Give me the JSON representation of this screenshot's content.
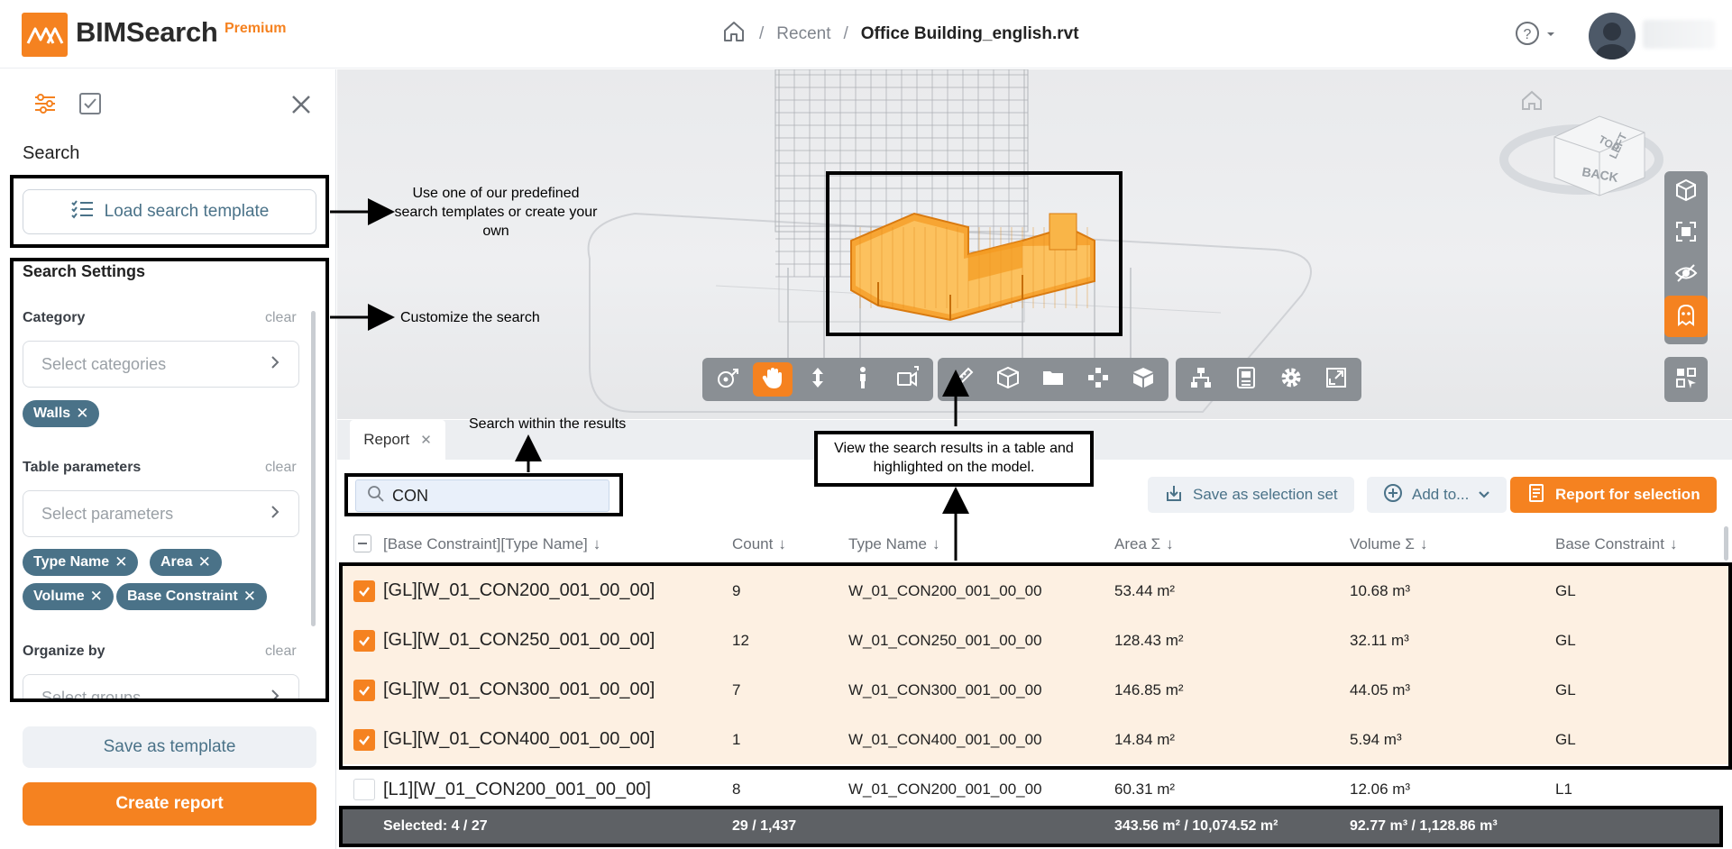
{
  "header": {
    "logo_text": "BIMSearch",
    "logo_badge": "Premium",
    "breadcrumb": {
      "recent": "Recent",
      "separator": "/",
      "file": "Office Building_english.rvt"
    }
  },
  "sidebar": {
    "search_title": "Search",
    "load_template_label": "Load search template",
    "settings_title": "Search Settings",
    "category": {
      "label": "Category",
      "clear": "clear",
      "placeholder": "Select categories",
      "chips": [
        "Walls"
      ]
    },
    "table_parameters": {
      "label": "Table parameters",
      "clear": "clear",
      "placeholder": "Select parameters",
      "chips": [
        "Type Name",
        "Area",
        "Volume",
        "Base Constraint"
      ]
    },
    "organize_by": {
      "label": "Organize by",
      "clear": "clear",
      "placeholder": "Select groups"
    },
    "save_template_label": "Save as template",
    "create_report_label": "Create report"
  },
  "annotations": {
    "templates": "Use one of our predefined search templates or create your own",
    "customize": "Customize the search",
    "search_within": "Search within the results",
    "view_results": "View the search results in a table and highlighted on the model."
  },
  "report": {
    "tab_label": "Report",
    "search_value": "CON",
    "buttons": {
      "save_selection": "Save as selection set",
      "add_to": "Add to...",
      "report_selection": "Report for selection"
    },
    "columns": [
      "[Base Constraint][Type Name]",
      "Count",
      "Type Name",
      "Area Σ",
      "Volume Σ",
      "Base Constraint"
    ],
    "rows": [
      {
        "checked": true,
        "group": "[GL][W_01_CON200_001_00_00]",
        "count": "9",
        "type_name": "W_01_CON200_001_00_00",
        "area": "53.44 m²",
        "volume": "10.68 m³",
        "base": "GL"
      },
      {
        "checked": true,
        "group": "[GL][W_01_CON250_001_00_00]",
        "count": "12",
        "type_name": "W_01_CON250_001_00_00",
        "area": "128.43 m²",
        "volume": "32.11 m³",
        "base": "GL"
      },
      {
        "checked": true,
        "group": "[GL][W_01_CON300_001_00_00]",
        "count": "7",
        "type_name": "W_01_CON300_001_00_00",
        "area": "146.85 m²",
        "volume": "44.05 m³",
        "base": "GL"
      },
      {
        "checked": true,
        "group": "[GL][W_01_CON400_001_00_00]",
        "count": "1",
        "type_name": "W_01_CON400_001_00_00",
        "area": "14.84 m²",
        "volume": "5.94 m³",
        "base": "GL"
      },
      {
        "checked": false,
        "group": "[L1][W_01_CON200_001_00_00]",
        "count": "8",
        "type_name": "W_01_CON200_001_00_00",
        "area": "60.31 m²",
        "volume": "12.06 m³",
        "base": "L1"
      }
    ],
    "footer": {
      "selected": "Selected: 4 / 27",
      "count": "29  / 1,437",
      "area": "343.56 m² / 10,074.52 m²",
      "volume": "92.77 m³ / 1,128.86 m³"
    }
  },
  "viewcube": {
    "top": "TOP",
    "back": "BACK",
    "left": "LEFT"
  },
  "colors": {
    "accent": "#f58220",
    "chip": "#4a7288",
    "selected_row": "#fdf0e2",
    "footer": "#5e6165"
  }
}
